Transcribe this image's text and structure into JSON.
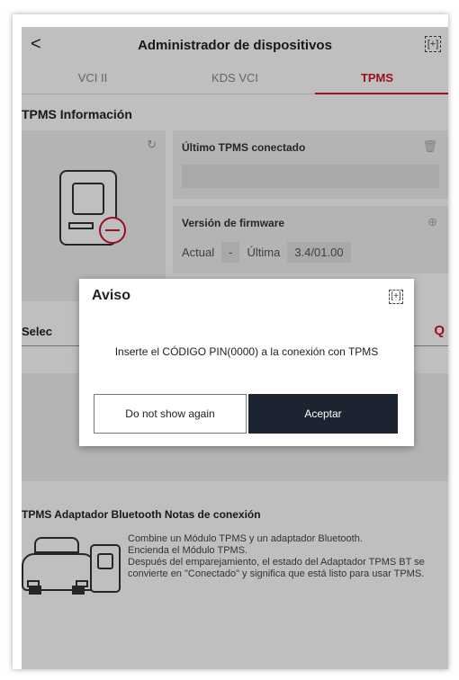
{
  "header": {
    "back_icon": "chevron-left-icon",
    "back_glyph": "<",
    "title": "Administrador de dispositivos",
    "expand_icon": "expand-icon",
    "expand_glyph": "[+]"
  },
  "tabs": [
    {
      "label": "VCI II",
      "active": false
    },
    {
      "label": "KDS VCI",
      "active": false
    },
    {
      "label": "TPMS",
      "active": true
    }
  ],
  "info_section": {
    "title": "TPMS Información",
    "refresh_icon": "refresh-icon",
    "last_connected": {
      "label": "Último TPMS conectado",
      "icon": "trash-icon"
    },
    "firmware": {
      "label": "Versión de firmware",
      "icon": "update-icon",
      "current_label": "Actual",
      "current_value": "-",
      "latest_label": "Última",
      "latest_value": "3.4/01.00"
    }
  },
  "select_section": {
    "label": "Selec",
    "search_icon": "search-icon"
  },
  "notes": {
    "title": "TPMS Adaptador Bluetooth Notas de conexión",
    "text": "  Combine un Módulo TPMS y un adaptador Bluetooth.\n  Encienda el Módulo TPMS.\n  Después del emparejamiento, el estado del Adaptador TPMS BT se convierte en \"Conectado\" y significa que está listo para usar TPMS."
  },
  "dialog": {
    "title": "Aviso",
    "expand_glyph": "[+]",
    "message": "Inserte el CÓDIGO PIN(0000) a la conexión con TPMS",
    "secondary_label": "Do not show again",
    "primary_label": "Aceptar"
  },
  "colors": {
    "accent": "#d0142c",
    "primary_button": "#1c2431",
    "card_bg": "#f1f1f1"
  }
}
